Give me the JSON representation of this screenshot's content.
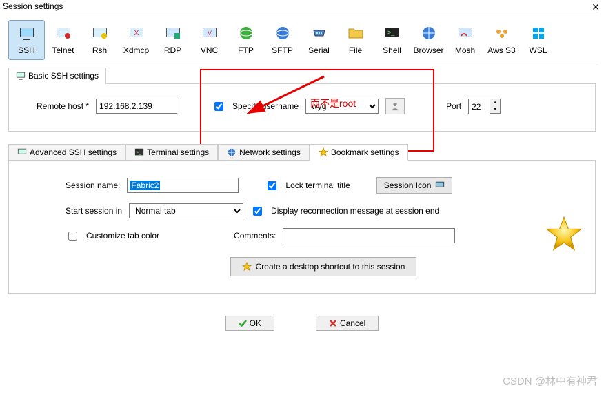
{
  "window": {
    "title": "Session settings"
  },
  "session_types": [
    {
      "label": "SSH"
    },
    {
      "label": "Telnet"
    },
    {
      "label": "Rsh"
    },
    {
      "label": "Xdmcp"
    },
    {
      "label": "RDP"
    },
    {
      "label": "VNC"
    },
    {
      "label": "FTP"
    },
    {
      "label": "SFTP"
    },
    {
      "label": "Serial"
    },
    {
      "label": "File"
    },
    {
      "label": "Shell"
    },
    {
      "label": "Browser"
    },
    {
      "label": "Mosh"
    },
    {
      "label": "Aws S3"
    },
    {
      "label": "WSL"
    }
  ],
  "basic_tab": "Basic SSH settings",
  "basic": {
    "remote_host_label": "Remote host *",
    "remote_host_value": "192.168.2.139",
    "specify_username_label": "Specify username",
    "username_value": "wyg",
    "port_label": "Port",
    "port_value": "22"
  },
  "annotation": {
    "text": "而不是root"
  },
  "settings_tabs": {
    "advanced": "Advanced SSH settings",
    "terminal": "Terminal settings",
    "network": "Network settings",
    "bookmark": "Bookmark settings"
  },
  "bookmark": {
    "session_name_label": "Session name:",
    "session_name_value": "Fabric2",
    "lock_title_label": "Lock terminal title",
    "session_icon_btn": "Session Icon",
    "start_session_label": "Start session in",
    "start_session_value": "Normal tab",
    "display_reconn_label": "Display reconnection message at session end",
    "customize_tab_label": "Customize tab color",
    "comments_label": "Comments:",
    "comments_value": "",
    "shortcut_btn": "Create a desktop shortcut to this session"
  },
  "buttons": {
    "ok": "OK",
    "cancel": "Cancel"
  },
  "watermark": "CSDN @林中有神君"
}
